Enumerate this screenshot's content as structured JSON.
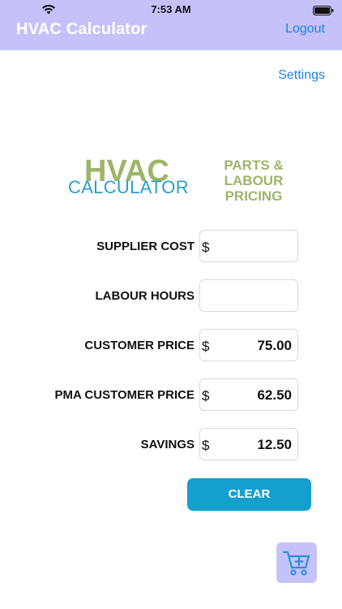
{
  "status_bar": {
    "time": "7:53 AM"
  },
  "header": {
    "title": "HVAC Calculator",
    "logout_label": "Logout"
  },
  "settings_label": "Settings",
  "logo": {
    "line1": "HVAC",
    "line2": "CALCULATOR"
  },
  "pricing": {
    "line1": "PARTS &",
    "line2": "LABOUR",
    "line3": "PRICING"
  },
  "form": {
    "supplier_cost": {
      "label": "SUPPLIER COST",
      "currency": "$",
      "value": ""
    },
    "labour_hours": {
      "label": "LABOUR HOURS",
      "value": ""
    },
    "customer_price": {
      "label": "CUSTOMER PRICE",
      "currency": "$",
      "value": "75.00"
    },
    "pma_customer_price": {
      "label": "PMA CUSTOMER PRICE",
      "currency": "$",
      "value": "62.50"
    },
    "savings": {
      "label": "SAVINGS",
      "currency": "$",
      "value": "12.50"
    }
  },
  "clear_label": "CLEAR",
  "icons": {
    "wifi": "wifi-icon",
    "battery": "battery-icon",
    "cart": "cart-add-icon"
  },
  "colors": {
    "header_bg": "#c5c2fa",
    "link": "#1a86e0",
    "logo_green": "#9cb56a",
    "logo_blue": "#2a9ec9",
    "button": "#159fce"
  }
}
